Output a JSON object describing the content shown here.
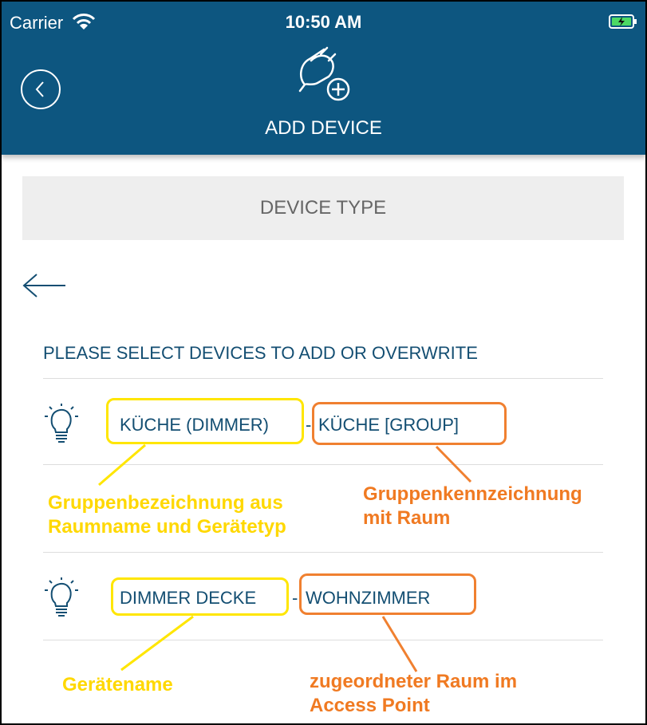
{
  "status_bar": {
    "carrier": "Carrier",
    "time": "10:50 AM"
  },
  "header": {
    "title": "ADD DEVICE"
  },
  "device_type_label": "DEVICE TYPE",
  "prompt": "PLEASE SELECT DEVICES TO ADD OR OVERWRITE",
  "devices": [
    {
      "name": "KÜCHE (DIMMER)",
      "room": "KÜCHE [GROUP]"
    },
    {
      "name": "DIMMER DECKE",
      "room": "WOHNZIMMER"
    }
  ],
  "separator": "-",
  "annotations": {
    "group_name": [
      "Gruppenbezeichnung aus",
      "Raumname und Gerätetyp"
    ],
    "group_id": [
      "Gruppenkennzeichnung",
      "mit Raum"
    ],
    "device_name": "Gerätename",
    "assigned_room": [
      "zugeordneter Raum im",
      "Access Point"
    ]
  },
  "colors": {
    "header": "#0d5680",
    "text": "#134e72",
    "yellow": "#ffe600",
    "orange": "#f08030"
  }
}
